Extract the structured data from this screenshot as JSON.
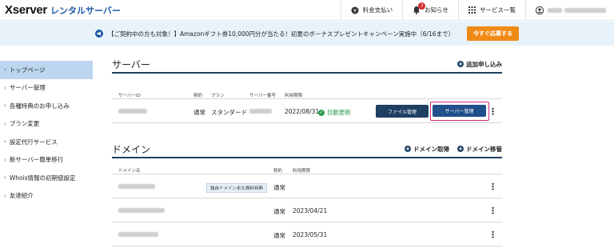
{
  "header": {
    "logo_main": "Xserver",
    "logo_sub": "レンタルサーバー",
    "nav": [
      {
        "label": "料金支払い",
        "icon": "payment-icon"
      },
      {
        "label": "お知らせ",
        "icon": "bell-icon",
        "badge": "3"
      },
      {
        "label": "サービス一覧",
        "icon": "grid-icon"
      }
    ]
  },
  "announcement": {
    "text": "【ご契約中の方も対象！】Amazonギフト券10,000円分が当たる！初夏のボーナスプレゼントキャンペーン実施中（6/16まで）",
    "cta": "今すぐ応募する"
  },
  "sidebar": {
    "items": [
      {
        "label": "トップページ",
        "active": true
      },
      {
        "label": "サーバー管理"
      },
      {
        "label": "各種特典のお申し込み"
      },
      {
        "label": "プラン変更"
      },
      {
        "label": "設定代行サービス"
      },
      {
        "label": "新サーバー簡単移行"
      },
      {
        "label": "Whois情報の初期値設定"
      },
      {
        "label": "友達紹介"
      }
    ]
  },
  "server_section": {
    "title": "サーバー",
    "add_link": "追加申し込み",
    "columns": [
      "サーバーID",
      "契約",
      "プラン",
      "サーバー番号",
      "利用期限"
    ],
    "row": {
      "contract": "通常",
      "plan": "スタンダード",
      "expiry": "2022/08/31",
      "auto_renew": "自動更新",
      "file_btn": "ファイル管理",
      "server_btn": "サーバー管理"
    }
  },
  "domain_section": {
    "title": "ドメイン",
    "links": [
      "ドメイン取得",
      "ドメイン移管"
    ],
    "columns": [
      "ドメイン名",
      "契約",
      "利用期限"
    ],
    "rows": [
      {
        "tag": "独自ドメイン永久無料特典",
        "contract": "通常",
        "expiry": ""
      },
      {
        "tag": "",
        "contract": "通常",
        "expiry": "2023/04/21"
      },
      {
        "tag": "",
        "contract": "通常",
        "expiry": "2023/05/31"
      }
    ]
  },
  "colors": {
    "navy": "#1f3f63",
    "accent_blue": "#22508a",
    "highlight": "#d12b7a",
    "cta_orange": "#f08a16",
    "ok_green": "#2d9c4e"
  }
}
